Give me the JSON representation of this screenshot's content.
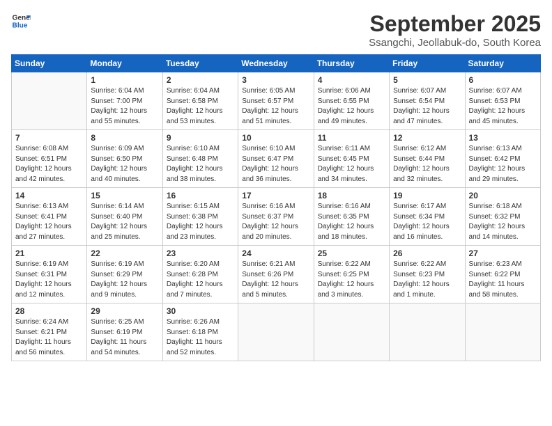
{
  "header": {
    "logo_line1": "General",
    "logo_line2": "Blue",
    "month": "September 2025",
    "location": "Ssangchi, Jeollabuk-do, South Korea"
  },
  "days_of_week": [
    "Sunday",
    "Monday",
    "Tuesday",
    "Wednesday",
    "Thursday",
    "Friday",
    "Saturday"
  ],
  "weeks": [
    [
      {
        "day": "",
        "info": ""
      },
      {
        "day": "1",
        "info": "Sunrise: 6:04 AM\nSunset: 7:00 PM\nDaylight: 12 hours\nand 55 minutes."
      },
      {
        "day": "2",
        "info": "Sunrise: 6:04 AM\nSunset: 6:58 PM\nDaylight: 12 hours\nand 53 minutes."
      },
      {
        "day": "3",
        "info": "Sunrise: 6:05 AM\nSunset: 6:57 PM\nDaylight: 12 hours\nand 51 minutes."
      },
      {
        "day": "4",
        "info": "Sunrise: 6:06 AM\nSunset: 6:55 PM\nDaylight: 12 hours\nand 49 minutes."
      },
      {
        "day": "5",
        "info": "Sunrise: 6:07 AM\nSunset: 6:54 PM\nDaylight: 12 hours\nand 47 minutes."
      },
      {
        "day": "6",
        "info": "Sunrise: 6:07 AM\nSunset: 6:53 PM\nDaylight: 12 hours\nand 45 minutes."
      }
    ],
    [
      {
        "day": "7",
        "info": "Sunrise: 6:08 AM\nSunset: 6:51 PM\nDaylight: 12 hours\nand 42 minutes."
      },
      {
        "day": "8",
        "info": "Sunrise: 6:09 AM\nSunset: 6:50 PM\nDaylight: 12 hours\nand 40 minutes."
      },
      {
        "day": "9",
        "info": "Sunrise: 6:10 AM\nSunset: 6:48 PM\nDaylight: 12 hours\nand 38 minutes."
      },
      {
        "day": "10",
        "info": "Sunrise: 6:10 AM\nSunset: 6:47 PM\nDaylight: 12 hours\nand 36 minutes."
      },
      {
        "day": "11",
        "info": "Sunrise: 6:11 AM\nSunset: 6:45 PM\nDaylight: 12 hours\nand 34 minutes."
      },
      {
        "day": "12",
        "info": "Sunrise: 6:12 AM\nSunset: 6:44 PM\nDaylight: 12 hours\nand 32 minutes."
      },
      {
        "day": "13",
        "info": "Sunrise: 6:13 AM\nSunset: 6:42 PM\nDaylight: 12 hours\nand 29 minutes."
      }
    ],
    [
      {
        "day": "14",
        "info": "Sunrise: 6:13 AM\nSunset: 6:41 PM\nDaylight: 12 hours\nand 27 minutes."
      },
      {
        "day": "15",
        "info": "Sunrise: 6:14 AM\nSunset: 6:40 PM\nDaylight: 12 hours\nand 25 minutes."
      },
      {
        "day": "16",
        "info": "Sunrise: 6:15 AM\nSunset: 6:38 PM\nDaylight: 12 hours\nand 23 minutes."
      },
      {
        "day": "17",
        "info": "Sunrise: 6:16 AM\nSunset: 6:37 PM\nDaylight: 12 hours\nand 20 minutes."
      },
      {
        "day": "18",
        "info": "Sunrise: 6:16 AM\nSunset: 6:35 PM\nDaylight: 12 hours\nand 18 minutes."
      },
      {
        "day": "19",
        "info": "Sunrise: 6:17 AM\nSunset: 6:34 PM\nDaylight: 12 hours\nand 16 minutes."
      },
      {
        "day": "20",
        "info": "Sunrise: 6:18 AM\nSunset: 6:32 PM\nDaylight: 12 hours\nand 14 minutes."
      }
    ],
    [
      {
        "day": "21",
        "info": "Sunrise: 6:19 AM\nSunset: 6:31 PM\nDaylight: 12 hours\nand 12 minutes."
      },
      {
        "day": "22",
        "info": "Sunrise: 6:19 AM\nSunset: 6:29 PM\nDaylight: 12 hours\nand 9 minutes."
      },
      {
        "day": "23",
        "info": "Sunrise: 6:20 AM\nSunset: 6:28 PM\nDaylight: 12 hours\nand 7 minutes."
      },
      {
        "day": "24",
        "info": "Sunrise: 6:21 AM\nSunset: 6:26 PM\nDaylight: 12 hours\nand 5 minutes."
      },
      {
        "day": "25",
        "info": "Sunrise: 6:22 AM\nSunset: 6:25 PM\nDaylight: 12 hours\nand 3 minutes."
      },
      {
        "day": "26",
        "info": "Sunrise: 6:22 AM\nSunset: 6:23 PM\nDaylight: 12 hours\nand 1 minute."
      },
      {
        "day": "27",
        "info": "Sunrise: 6:23 AM\nSunset: 6:22 PM\nDaylight: 11 hours\nand 58 minutes."
      }
    ],
    [
      {
        "day": "28",
        "info": "Sunrise: 6:24 AM\nSunset: 6:21 PM\nDaylight: 11 hours\nand 56 minutes."
      },
      {
        "day": "29",
        "info": "Sunrise: 6:25 AM\nSunset: 6:19 PM\nDaylight: 11 hours\nand 54 minutes."
      },
      {
        "day": "30",
        "info": "Sunrise: 6:26 AM\nSunset: 6:18 PM\nDaylight: 11 hours\nand 52 minutes."
      },
      {
        "day": "",
        "info": ""
      },
      {
        "day": "",
        "info": ""
      },
      {
        "day": "",
        "info": ""
      },
      {
        "day": "",
        "info": ""
      }
    ]
  ]
}
